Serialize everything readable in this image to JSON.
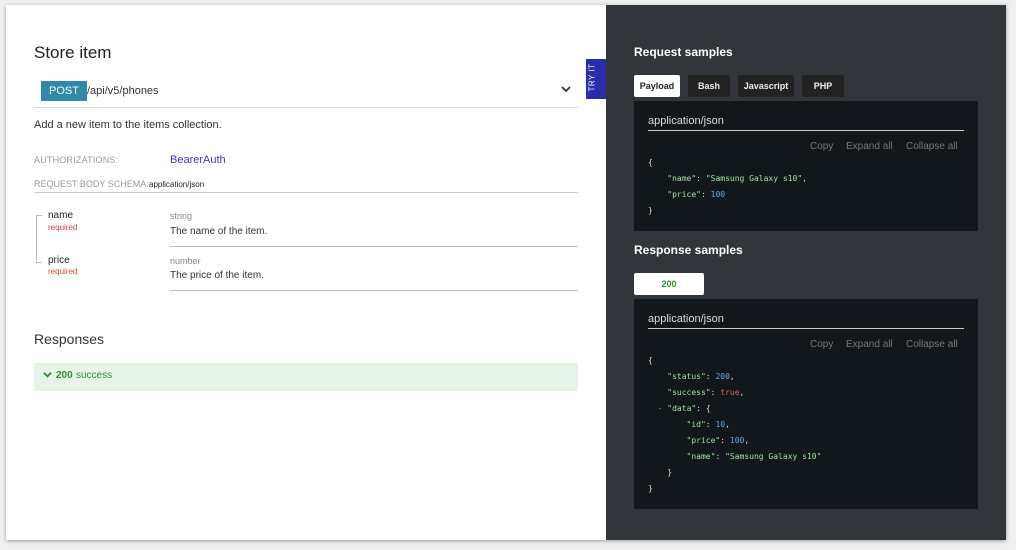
{
  "left": {
    "title": "Store item",
    "method": "POST",
    "path": "/api/v5/phones",
    "description": "Add a new item to the items collection.",
    "auth_label": "AUTHORIZATIONS:",
    "auth_value": "BearerAuth",
    "schema_label": "REQUEST BODY SCHEMA:",
    "schema_value": "application/json",
    "fields": [
      {
        "name": "name",
        "required": "required",
        "type": "string",
        "description": "The name of the item."
      },
      {
        "name": "price",
        "required": "required",
        "type": "number",
        "description": "The price of the item."
      }
    ],
    "responses_title": "Responses",
    "response": {
      "code": "200",
      "text": "success"
    }
  },
  "try_it": "TRY IT",
  "right": {
    "request_title": "Request samples",
    "tabs": [
      "Payload",
      "Bash",
      "Javascript",
      "PHP"
    ],
    "content_type": "application/json",
    "tools": [
      "Copy",
      "Expand all",
      "Collapse all"
    ],
    "request_code": {
      "name_key": "\"name\"",
      "name_value": "\"Samsung Galaxy s10\"",
      "price_key": "\"price\"",
      "price_value": "100"
    },
    "response_title": "Response samples",
    "response_tab": "200",
    "response_code": {
      "status_key": "\"status\"",
      "status_value": "200",
      "success_key": "\"success\"",
      "success_value": "true",
      "data_key": "\"data\"",
      "id_key": "\"id\"",
      "id_value": "10",
      "price_key": "\"price\"",
      "price_value": "100",
      "name_key": "\"name\"",
      "name_value": "\"Samsung Galaxy s10\""
    }
  },
  "colors": {
    "method_bg": "#2e8aa8",
    "auth_link": "#3c3ab0",
    "required": "#d94141",
    "success": "#2e8f2e",
    "right_panel_bg": "#323539",
    "code_bg": "#11171a",
    "try_it_bg": "#2b2da8"
  }
}
